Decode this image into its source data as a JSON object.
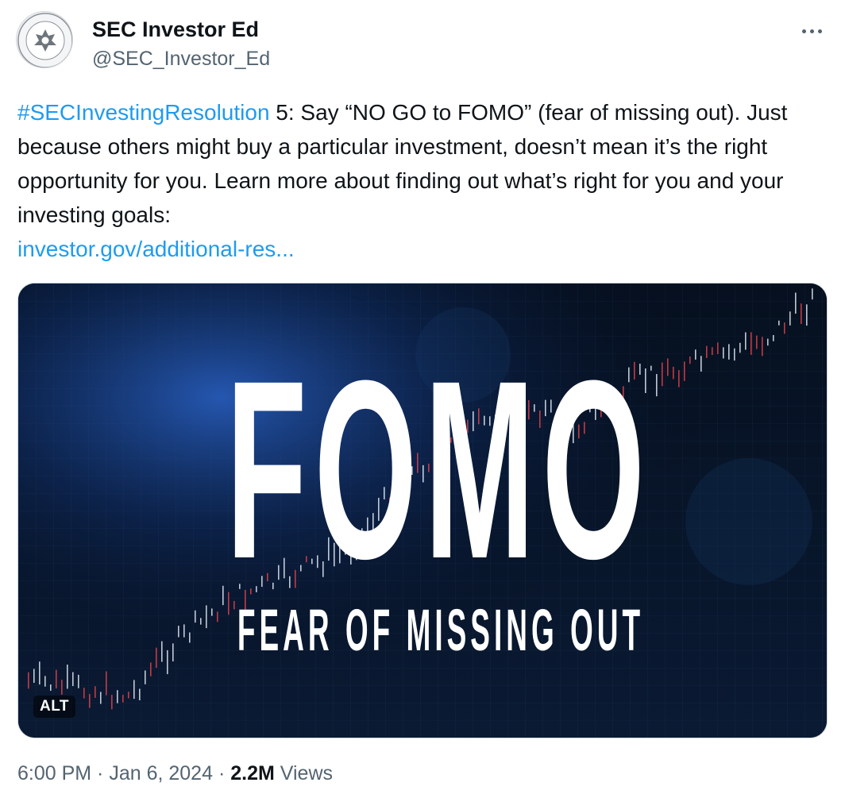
{
  "account": {
    "display_name": "SEC Investor Ed",
    "handle": "@SEC_Investor_Ed"
  },
  "tweet": {
    "hashtag": "#SECInvestingResolution",
    "body": " 5: Say “NO GO to FOMO” (fear of missing out). Just because others might buy a particular investment, doesn’t mean it’s the right opportunity for you. Learn more about finding out what’s right for you and your investing goals:",
    "link": "investor.gov/additional-res..."
  },
  "media": {
    "headline": "FOMO",
    "subheadline": "FEAR OF MISSING OUT",
    "alt_badge": "ALT"
  },
  "meta": {
    "time": "6:00 PM",
    "separator1": " · ",
    "date": "Jan 6, 2024",
    "separator2": " · ",
    "views_count": "2.2M",
    "views_label": " Views"
  },
  "colors": {
    "link": "#1d9bf0",
    "secondary_text": "#536471",
    "primary_text": "#0f1419",
    "candle_up": "#e0eaf5",
    "candle_down": "#e0434b"
  }
}
